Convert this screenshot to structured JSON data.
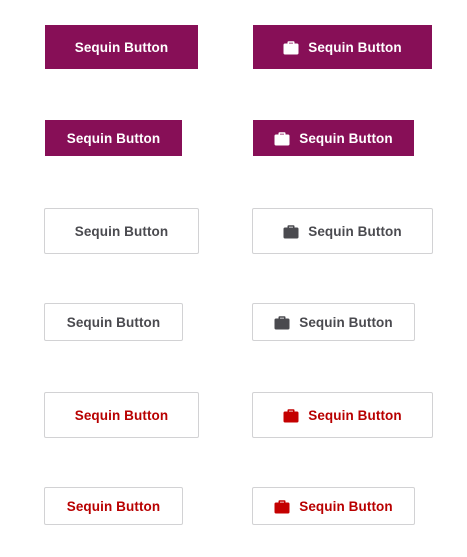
{
  "buttons": {
    "label": "Sequin Button",
    "icon": "briefcase-icon"
  },
  "colors": {
    "primary": "#870f57",
    "primary_text": "#ffffff",
    "secondary_text": "#4a4a4f",
    "danger_text": "#b80000",
    "border": "#d2d2d4"
  }
}
